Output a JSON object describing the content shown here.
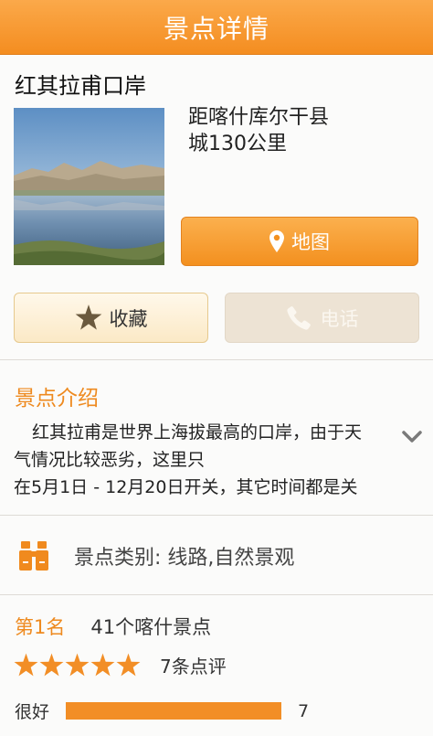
{
  "header": {
    "title": "景点详情"
  },
  "spot": {
    "name": "红其拉甫口岸",
    "distance_line1": "距喀什库尔干县",
    "distance_line2": "城130公里"
  },
  "actions": {
    "map_label": "地图",
    "favorite_label": "收藏",
    "phone_label": "电话",
    "phone_enabled": false
  },
  "intro": {
    "title": "景点介绍",
    "line1": "红其拉甫是世界上海拔最高的口岸，由于天",
    "line2": "气情况比较恶劣，这里只",
    "line3": "在5月1日 - 12月20日开关，其它时间都是关"
  },
  "category": {
    "label": "景点类别:  线路,自然景观"
  },
  "ranking": {
    "rank": "第1名",
    "desc": "41个喀什景点"
  },
  "reviews": {
    "stars": 5,
    "count_text": "7条点评",
    "breakdown": [
      {
        "label": "很好",
        "count": "7",
        "fraction": 1.0
      }
    ]
  },
  "colors": {
    "accent": "#f48d20",
    "star": "#f28e26",
    "phone_disabled": "#ede3d4"
  },
  "icons": {
    "map": "location-pin-icon",
    "favorite": "star-icon",
    "phone": "phone-icon",
    "category": "binoculars-icon",
    "expand": "chevron-down-icon"
  }
}
